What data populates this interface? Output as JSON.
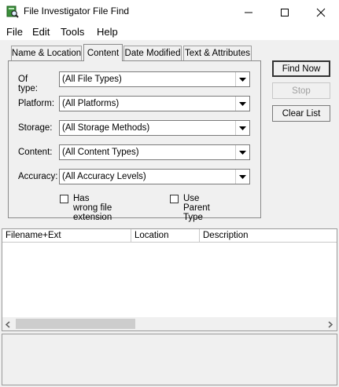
{
  "window": {
    "title": "File Investigator File Find",
    "controls": [
      "minimize-icon",
      "maximize-icon",
      "close-icon"
    ]
  },
  "menu": [
    "File",
    "Edit",
    "Tools",
    "Help"
  ],
  "tabs": [
    {
      "label": "Name & Location",
      "active": false
    },
    {
      "label": "Content",
      "active": true
    },
    {
      "label": "Date Modified",
      "active": false
    },
    {
      "label": "Text & Attributes",
      "active": false
    }
  ],
  "fields": {
    "type": {
      "label": "Of type:",
      "value": "(All File Types)"
    },
    "platform": {
      "label": "Platform:",
      "value": "(All Platforms)"
    },
    "storage": {
      "label": "Storage:",
      "value": "(All Storage Methods)"
    },
    "content": {
      "label": "Content:",
      "value": "(All Content Types)"
    },
    "accuracy": {
      "label": "Accuracy:",
      "value": "(All Accuracy Levels)"
    }
  },
  "checkboxes": {
    "wrong_ext": {
      "label": "Has wrong file extension",
      "checked": false
    },
    "parent_type": {
      "label": "Use Parent Type",
      "checked": false
    }
  },
  "buttons": {
    "find_now": "Find Now",
    "stop": "Stop",
    "clear_list": "Clear List"
  },
  "list_columns": [
    "Filename+Ext",
    "Location",
    "Description"
  ],
  "colors": {
    "window_bg": "#f0f0f0",
    "field_bg": "#ffffff",
    "border": "#7a7a7a",
    "disabled_text": "#a0a0a0"
  }
}
